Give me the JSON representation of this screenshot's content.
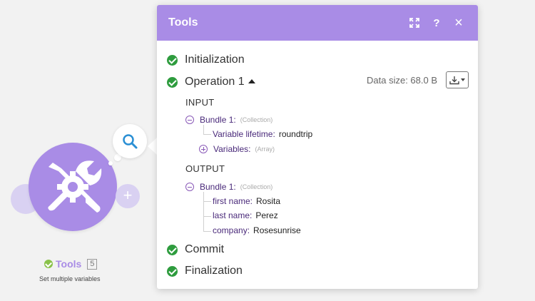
{
  "module": {
    "name": "Tools",
    "count": "5",
    "subtitle": "Set multiple variables",
    "plus": "+"
  },
  "panel": {
    "title": "Tools",
    "header_buttons": [
      {
        "icon": "expand-icon"
      },
      {
        "icon": "help-icon",
        "label": "?"
      },
      {
        "icon": "close-icon",
        "label": "×"
      }
    ],
    "operations": [
      {
        "label": "Initialization",
        "status": "success"
      },
      {
        "label": "Operation 1",
        "status": "success",
        "expanded": true
      },
      {
        "label": "Commit",
        "status": "success"
      },
      {
        "label": "Finalization",
        "status": "success"
      }
    ],
    "data_size": "Data size: 68.0 B",
    "input": {
      "heading": "INPUT",
      "bundle_label": "Bundle 1:",
      "bundle_type": "(Collection)",
      "items": [
        {
          "key": "Variable lifetime:",
          "value": "roundtrip"
        },
        {
          "key": "Variables:",
          "type": "(Array)"
        }
      ]
    },
    "output": {
      "heading": "OUTPUT",
      "bundle_label": "Bundle 1:",
      "bundle_type": "(Collection)",
      "items": [
        {
          "key": "first name:",
          "value": "Rosita"
        },
        {
          "key": "last name:",
          "value": "Perez"
        },
        {
          "key": "company:",
          "value": "Rosesunrise"
        }
      ]
    }
  },
  "colors": {
    "accent": "#a98ce6",
    "success": "#2e9c3e",
    "tree_text": "#4a2a7a"
  }
}
